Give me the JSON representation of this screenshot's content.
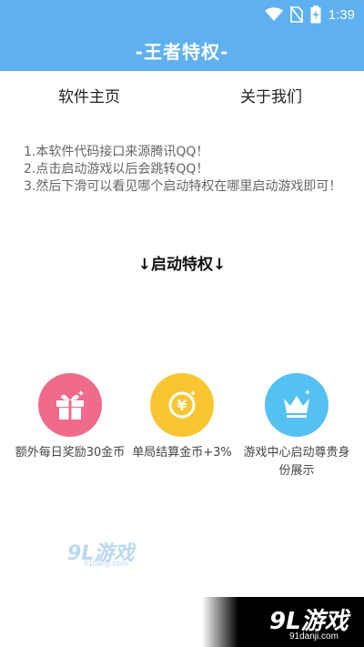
{
  "status_bar": {
    "time": "1:39",
    "icons": [
      "wifi-icon",
      "no-sim-icon",
      "battery-charging-icon"
    ]
  },
  "app_bar": {
    "title": "-王者特权-",
    "background": "#5fb0f0"
  },
  "tabs": [
    {
      "label": "软件主页"
    },
    {
      "label": "关于我们"
    }
  ],
  "notice": {
    "lines": [
      "1.本软件代码接口来源腾讯QQ！",
      "2.点击启动游戏以后会跳转QQ！",
      "3.然后下滑可以看见哪个启动特权在哪里启动游戏即可！"
    ]
  },
  "launch_section": {
    "title": "↓启动特权↓"
  },
  "features": [
    {
      "label": "额外每日奖励30金币",
      "icon": "gift-icon",
      "color": "#f06b8b"
    },
    {
      "label": "单局结算金币+3%",
      "icon": "coin-icon",
      "color": "#f9c531"
    },
    {
      "label": "游戏中心启动尊贵身份展示",
      "icon": "crown-icon",
      "color": "#55c1f2"
    }
  ],
  "watermarks": {
    "brand": "9L游戏",
    "site": "91danji.com"
  }
}
